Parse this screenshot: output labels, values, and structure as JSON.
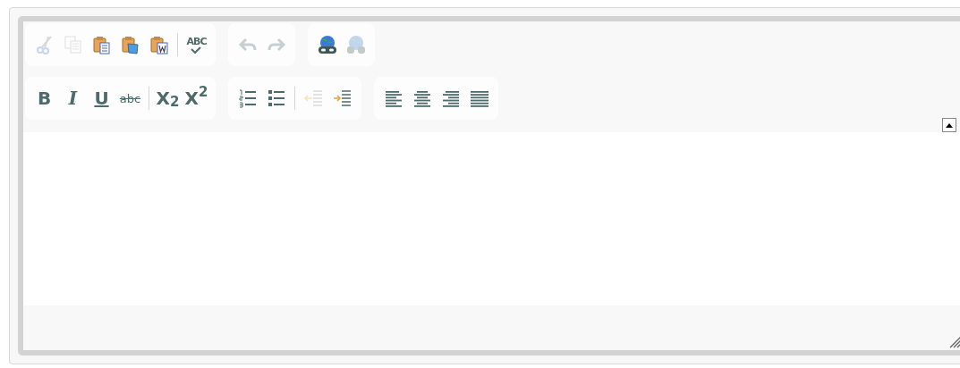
{
  "toolbar": {
    "rows": [
      [
        {
          "items": [
            {
              "kind": "cut",
              "disabled": true
            },
            {
              "kind": "copy",
              "disabled": true
            },
            {
              "kind": "paste",
              "disabled": false
            },
            {
              "kind": "paste-text",
              "disabled": false
            },
            {
              "kind": "paste-word",
              "disabled": false
            },
            {
              "kind": "separator"
            },
            {
              "kind": "spellcheck",
              "label": "ABC",
              "disabled": false
            }
          ]
        },
        {
          "items": [
            {
              "kind": "undo",
              "disabled": true
            },
            {
              "kind": "redo",
              "disabled": true
            }
          ]
        },
        {
          "items": [
            {
              "kind": "link",
              "disabled": false
            },
            {
              "kind": "unlink",
              "disabled": true
            }
          ]
        }
      ],
      [
        {
          "items": [
            {
              "kind": "bold",
              "label": "B",
              "disabled": false
            },
            {
              "kind": "italic",
              "label": "I",
              "disabled": false
            },
            {
              "kind": "underline",
              "label": "U",
              "disabled": false
            },
            {
              "kind": "strike",
              "label": "abc",
              "disabled": false
            },
            {
              "kind": "separator"
            },
            {
              "kind": "subscript",
              "label": "X$_{2}$",
              "disabled": false
            },
            {
              "kind": "superscript",
              "label": "X$^{2}$",
              "disabled": false
            }
          ]
        },
        {
          "items": [
            {
              "kind": "numbered-list",
              "disabled": false
            },
            {
              "kind": "bulleted-list",
              "disabled": false
            },
            {
              "kind": "separator"
            },
            {
              "kind": "outdent",
              "disabled": true
            },
            {
              "kind": "indent",
              "disabled": false
            }
          ]
        },
        {
          "items": [
            {
              "kind": "align-left",
              "disabled": false
            },
            {
              "kind": "align-center",
              "disabled": false
            },
            {
              "kind": "align-right",
              "disabled": false
            },
            {
              "kind": "justify",
              "disabled": false
            }
          ]
        }
      ]
    ]
  },
  "collapsed": false
}
